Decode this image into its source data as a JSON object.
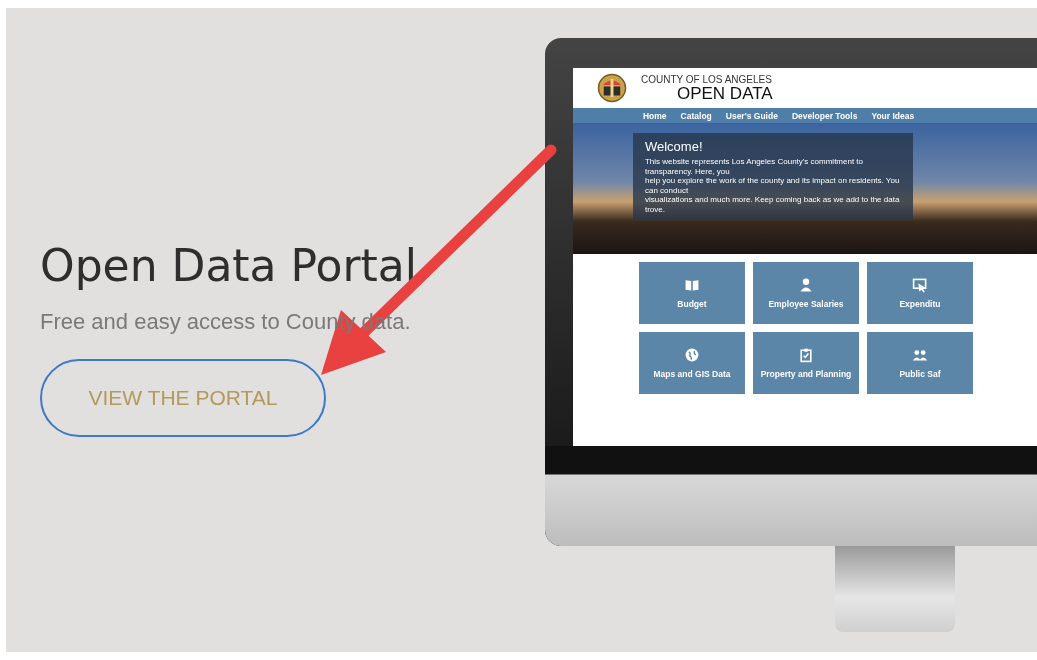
{
  "hero": {
    "title": "Open Data Portal",
    "subtitle": "Free and easy access to County data.",
    "button": "VIEW THE PORTAL"
  },
  "monitor": {
    "site": {
      "header_top": "COUNTY OF LOS ANGELES",
      "header_main": "OPEN DATA",
      "nav": [
        "Home",
        "Catalog",
        "User's Guide",
        "Developer Tools",
        "Your Ideas"
      ],
      "welcome": {
        "title": "Welcome!",
        "lines": [
          "This website represents Los Angeles County's commitment to transparency. Here, you",
          "help you explore the work of the county and its impact on residents. You can conduct",
          "visualizations and much more. Keep coming back as we add to the data trove."
        ]
      },
      "tiles": [
        {
          "kind": "book",
          "label": "Budget"
        },
        {
          "kind": "person",
          "label": "Employee Salaries"
        },
        {
          "kind": "pointer",
          "label": "Expenditu"
        },
        {
          "kind": "globe",
          "label": "Maps and GIS Data"
        },
        {
          "kind": "clipboard",
          "label": "Property and Planning"
        },
        {
          "kind": "people",
          "label": "Public Saf"
        }
      ]
    }
  }
}
